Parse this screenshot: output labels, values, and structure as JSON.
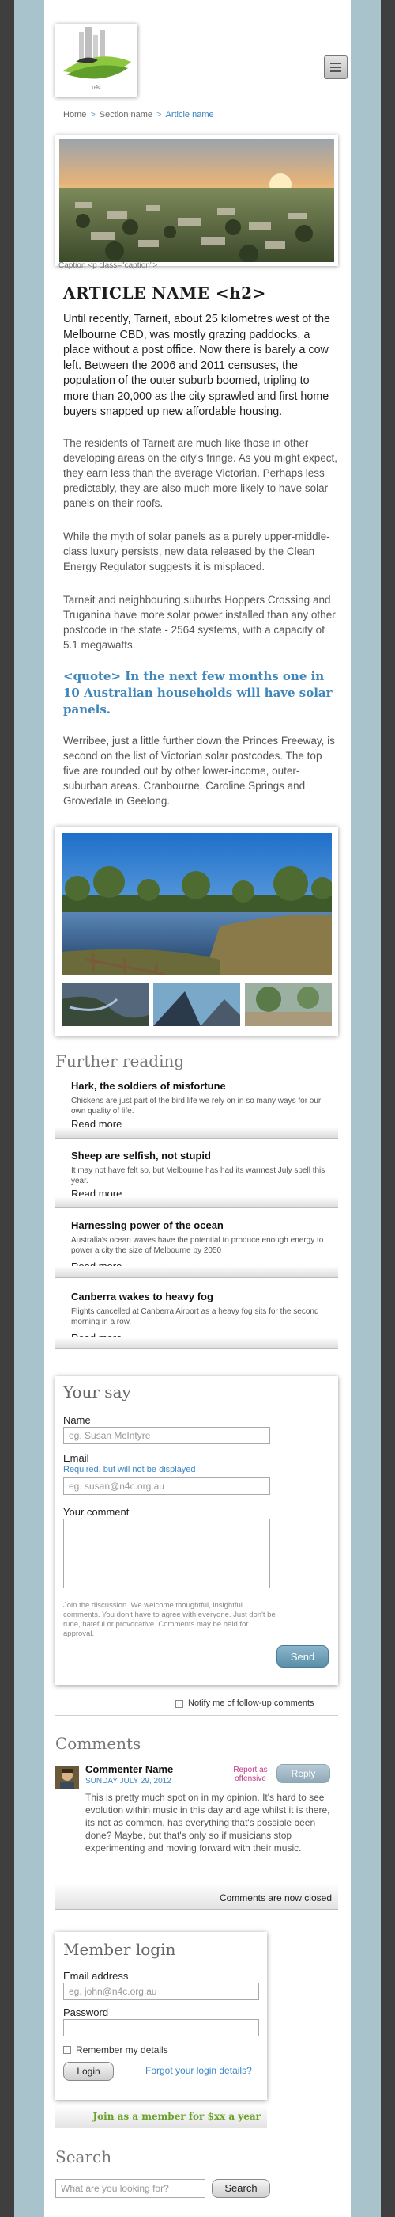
{
  "header": {
    "menu_label": "Menu"
  },
  "breadcrumb": [
    "Home",
    "Section name",
    "Article name"
  ],
  "article": {
    "caption": "Caption <p class=\"caption\">",
    "title": "ARTICLE NAME <h2>",
    "lead": "Until recently, Tarneit, about 25 kilometres west of the Melbourne CBD, was mostly grazing paddocks, a place without a post office. Now there is barely a cow left. Between the 2006 and 2011 censuses, the population of the outer suburb boomed, tripling to more than 20,000 as the city sprawled and first home buyers snapped up new affordable housing.",
    "para1": "The residents of Tarneit are much like those in other developing areas on the city's fringe. As you might expect, they earn less than the average Victorian. Perhaps less predictably, they are also much more likely to have solar panels on their roofs.",
    "para2": "While the myth of solar panels as a purely upper-middle-class luxury persists, new data released by the Clean Energy Regulator suggests it is misplaced.",
    "para3": "Tarneit and neighbouring suburbs Hoppers Crossing and Truganina have more solar power installed than any other postcode in the state - 2564 systems, with a capacity of 5.1 megawatts.",
    "quote": "<quote> In the next few months one in 10 Australian households will have solar panels.",
    "para4": "Werribee, just a little further down the Princes Freeway, is second on the list of Victorian solar postcodes. The top five are rounded out by other lower-income, outer-suburban areas. Cranbourne, Caroline Springs and Grovedale in Geelong."
  },
  "further_reading": {
    "heading": "Further reading",
    "items": [
      {
        "title": "Hark, the soldiers of misfortune",
        "summary": "Chickens are just part of the bird life we rely on in so many ways for our own quality of life.",
        "more": "Read more"
      },
      {
        "title": "Sheep are selfish, not stupid",
        "summary": "It may not have felt so, but Melbourne has had its warmest July spell this year.",
        "more": "Read more"
      },
      {
        "title": "Harnessing power of the ocean",
        "summary": "Australia's ocean waves have the potential to produce enough energy to power a city the size of Melbourne by 2050",
        "more": "Read more"
      },
      {
        "title": "Canberra wakes to heavy fog",
        "summary": "Flights cancelled at Canberra Airport as a heavy fog sits for the second morning in a row.",
        "more": "Read more"
      }
    ]
  },
  "your_say": {
    "heading": "Your say",
    "name_label": "Name",
    "name_placeholder": "eg. Susan McIntyre",
    "email_label": "Email",
    "email_hint": "Required, but will not be displayed",
    "email_placeholder": "eg. susan@n4c.org.au",
    "comment_label": "Your comment",
    "disclaimer": "Join the discussion. We welcome thoughtful, insightful comments. You don't have to agree with everyone. Just don't be rude, hateful or provocative. Comments may be held for approval.",
    "send_label": "Send",
    "notify_label": "Notify me of follow-up comments"
  },
  "comments": {
    "heading": "Comments",
    "items": [
      {
        "author": "Commenter Name",
        "date": "SUNDAY JULY 29, 2012",
        "report": "Report as offensive",
        "reply": "Reply",
        "text": "This is pretty much spot on in my opinion. It's hard to see evolution within music in this day and age whilst it is there, its not as common, has everything that's possible been done? Maybe, but that's only so if musicians stop experimenting and moving forward with their music."
      }
    ],
    "closed_notice": "Comments are now closed"
  },
  "member_login": {
    "heading": "Member login",
    "email_label": "Email address",
    "email_placeholder": "eg. john@n4c.org.au",
    "password_label": "Password",
    "remember_label": "Remember my details",
    "login_label": "Login",
    "forgot_label": "Forgot your login details?",
    "join_label": "Join as a member for $xx a year"
  },
  "search": {
    "heading": "Search",
    "placeholder": "What are you looking for?",
    "button_label": "Search"
  },
  "colors": {
    "accent_blue": "#3f86bb",
    "join_green": "#6aa12a",
    "report_pink": "#c0398a",
    "frame": "#a9c3cd"
  }
}
